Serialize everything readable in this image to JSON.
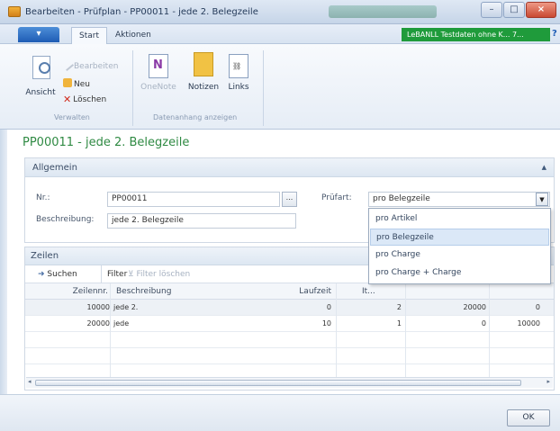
{
  "window": {
    "title": "Bearbeiten - Prüfplan - PP00011 - jede 2. Belegzeile",
    "min_symbol": "–",
    "max_symbol": "□",
    "close_symbol": "×"
  },
  "menu": {
    "app_button": "▾",
    "tabs": [
      "Start",
      "Aktionen"
    ],
    "company": "LeBANLL Testdaten ohne K... 7...",
    "help": "?"
  },
  "ribbon": {
    "ansicht": "Ansicht",
    "bearbeiten": "Bearbeiten",
    "neu": "Neu",
    "loeschen": "Löschen",
    "group_verwalten": "Verwalten",
    "onenote": "OneNote",
    "notizen": "Notizen",
    "links": "Links",
    "group_datenanhang": "Datenanhang anzeigen"
  },
  "page": {
    "title": "PP00011 - jede 2. Belegzeile"
  },
  "general": {
    "header": "Allgemein",
    "nr_label": "Nr.:",
    "nr_value": "PP00011",
    "lookup": "...",
    "beschreibung_label": "Beschreibung:",
    "beschreibung_value": "jede 2. Belegzeile",
    "pruefart_label": "Prüfart:",
    "pruefart_value": "pro Belegzeile"
  },
  "dropdown": {
    "options": [
      "pro Artikel",
      "pro Belegzeile",
      "pro Charge",
      "pro Charge + Charge"
    ],
    "selected": 1
  },
  "lines": {
    "header": "Zeilen",
    "toolbar": {
      "suchen": "Suchen",
      "filter": "Filter",
      "filter_loeschen": "Filter löschen"
    },
    "columns": [
      "Zeilennr.",
      "Beschreibung",
      "Laufzeit",
      "It..."
    ],
    "rows": [
      {
        "zeilennr": "10000",
        "beschreibung": "jede 2.",
        "laufzeit": "0",
        "c4": "2",
        "c5": "20000",
        "c6": "0"
      },
      {
        "zeilennr": "20000",
        "beschreibung": "jede",
        "laufzeit": "10",
        "c4": "1",
        "c5": "0",
        "c6": "10000"
      }
    ]
  },
  "footer": {
    "ok": "OK"
  }
}
